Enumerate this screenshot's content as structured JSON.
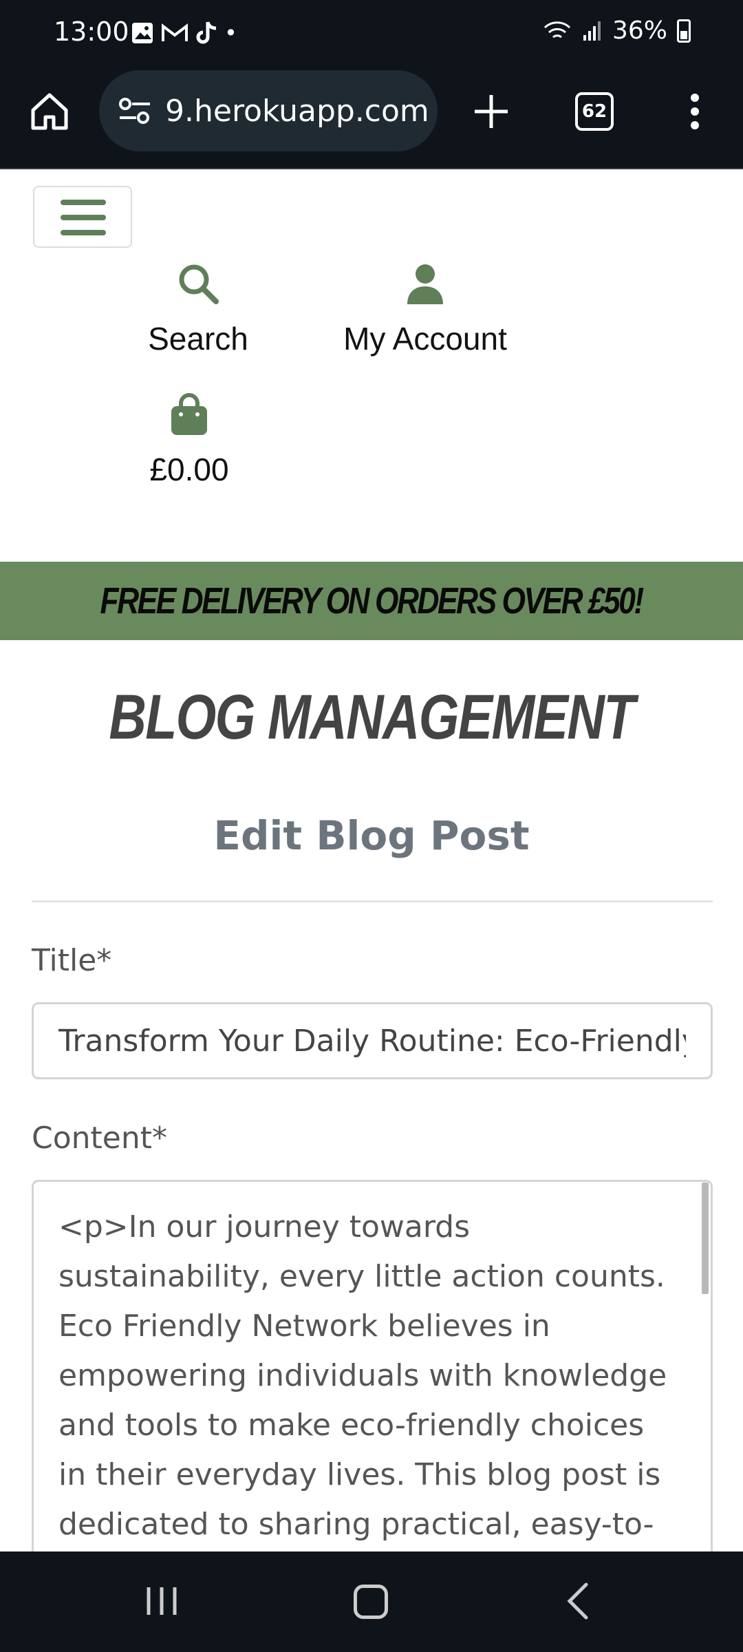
{
  "status_bar": {
    "time": "13:00",
    "notifications": [
      "image-icon",
      "gmail-icon",
      "tiktok-icon",
      "dot"
    ],
    "battery": "36%"
  },
  "browser": {
    "url": "9.herokuapp.com",
    "tab_count": "62"
  },
  "nav": {
    "search_label": "Search",
    "account_label": "My Account",
    "bag_total": "£0.00"
  },
  "banner": {
    "text": "FREE DELIVERY ON ORDERS OVER £50!"
  },
  "page": {
    "heading": "BLOG MANAGEMENT",
    "subheading": "Edit Blog Post"
  },
  "form": {
    "title_label": "Title*",
    "title_value": "Transform Your Daily Routine: Eco-Friendly I",
    "content_label": "Content*",
    "content_value": "<p>In our journey towards sustainability, every little action counts. Eco Friendly Network believes in empowering individuals with knowledge and tools to make eco-friendly choices in their everyday lives. This blog post is dedicated to sharing practical, easy-to-implement eco-friendly lifestyle changes..."
  },
  "colors": {
    "brand_green": "#698a5d",
    "icon_green": "#5f7f59",
    "system_bar": "#0e1419"
  }
}
